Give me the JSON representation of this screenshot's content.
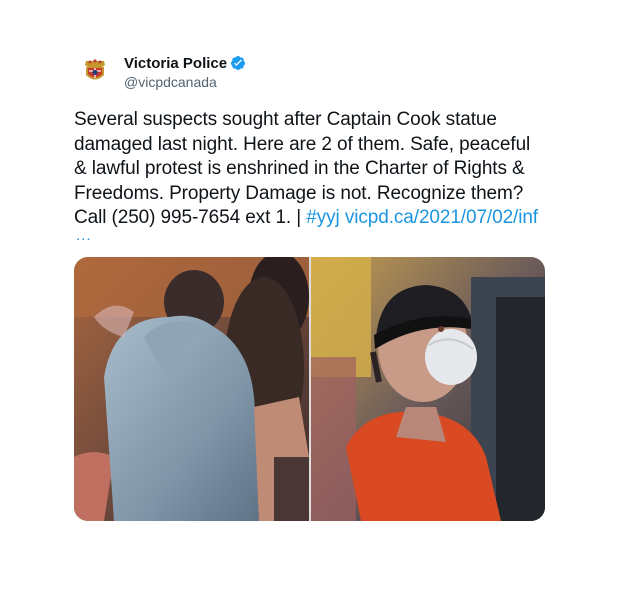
{
  "account": {
    "display_name": "Victoria Police",
    "handle": "@vicpdcanada",
    "avatar_icon": "police-crest-icon",
    "verified_icon": "verified-badge-icon",
    "avatar_text": "POLICE"
  },
  "tweet": {
    "text_line1": "Several suspects sought after Captain Cook statue",
    "text_line2": "damaged last night. Here are 2 of them. Safe, peaceful",
    "text_line3": "& lawful protest is enshrined in the Charter of Rights &",
    "text_line4": "Freedoms. Property Damage is not. Recognize them?",
    "text_line5_prefix": "Call (250) 995-7654 ext 1. | ",
    "hashtag": "#yyj",
    "link": "vicpd.ca/2021/07/02/inf",
    "more": "..."
  },
  "media": {
    "photos": [
      {
        "subject": "suspect-grey-hoodie"
      },
      {
        "subject": "suspect-orange-shirt-mask"
      }
    ]
  },
  "colors": {
    "link": "#1b95e0",
    "verified": "#1d9bf0",
    "text": "#0f1419",
    "secondary": "#536471"
  }
}
